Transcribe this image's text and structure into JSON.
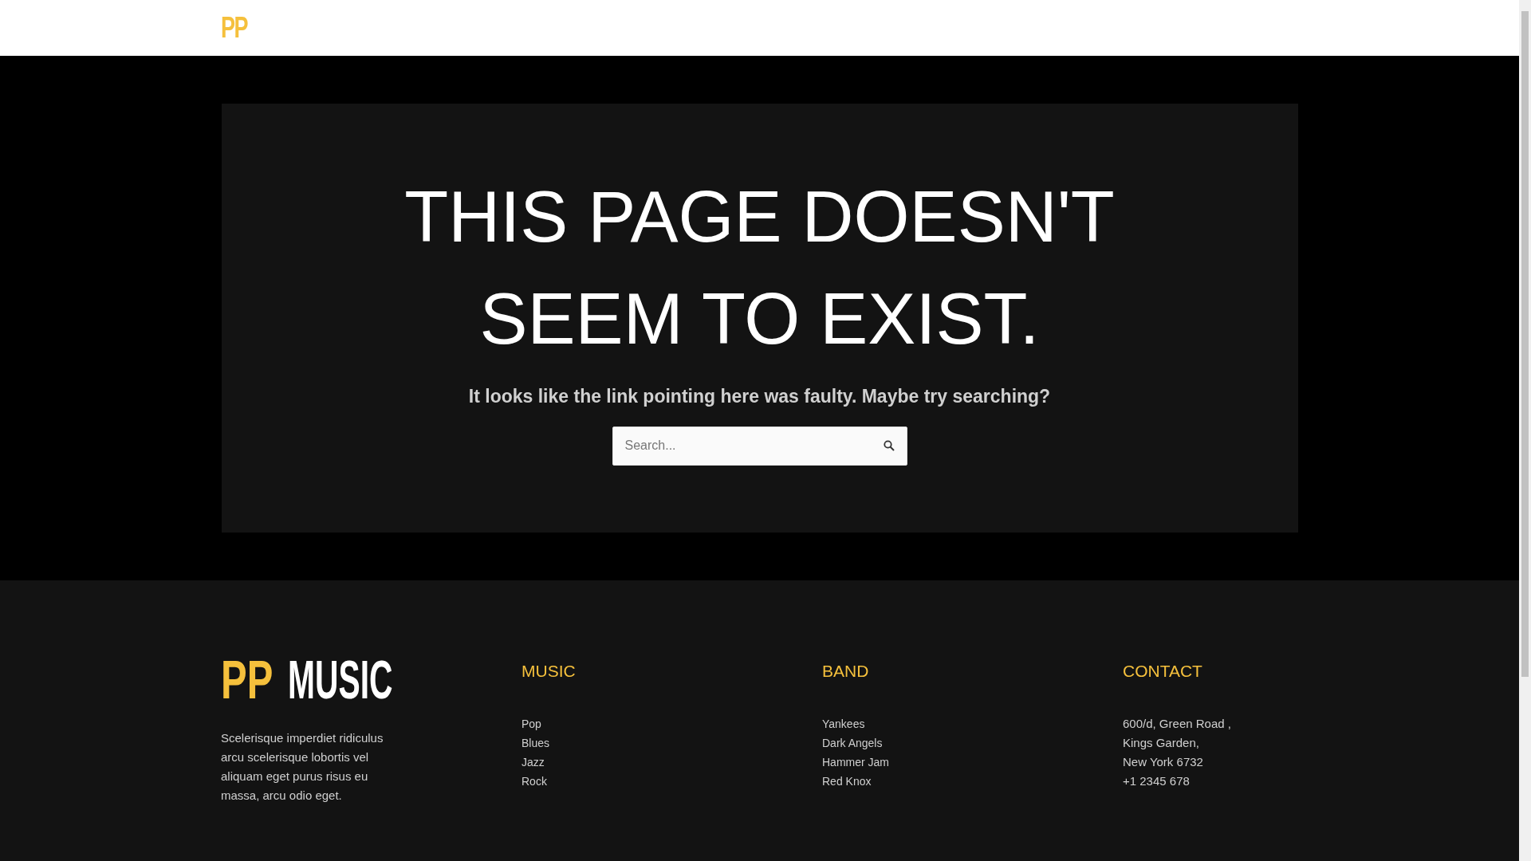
{
  "header": {
    "logo": "PP"
  },
  "error": {
    "title": "THIS PAGE DOESN'T SEEM TO EXIST.",
    "message": "It looks like the link pointing here was faulty. Maybe try searching?",
    "search": {
      "placeholder": "Search..."
    }
  },
  "footer": {
    "logo": {
      "accent": "PP",
      "rest": "MUSIC"
    },
    "about": "Scelerisque imperdiet ridiculus arcu scelerisque lobortis vel aliquam eget purus risus eu massa, arcu odio eget.",
    "columns": [
      {
        "title": "MUSIC",
        "kind": "links",
        "items": [
          "Pop",
          "Blues",
          "Jazz",
          "Rock"
        ]
      },
      {
        "title": "BAND",
        "kind": "links",
        "items": [
          "Yankees",
          "Dark Angels",
          "Hammer Jam",
          "Red Knox"
        ]
      },
      {
        "title": "CONTACT",
        "kind": "text",
        "items": [
          "600/d, Green Road ,",
          "Kings Garden,",
          "New York 6732",
          "+1 2345 678"
        ]
      }
    ]
  }
}
